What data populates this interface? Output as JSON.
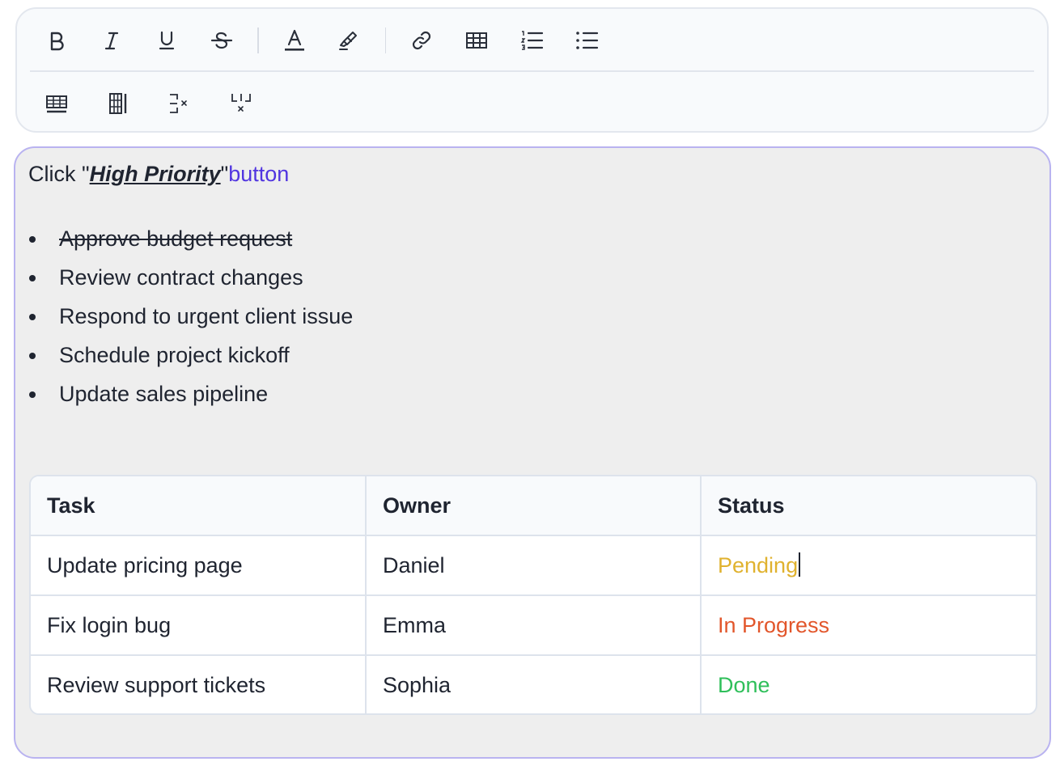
{
  "toolbar": {
    "row1": [
      {
        "name": "bold-button",
        "icon": "bold-icon"
      },
      {
        "name": "italic-button",
        "icon": "italic-icon"
      },
      {
        "name": "underline-button",
        "icon": "underline-icon"
      },
      {
        "name": "strikethrough-button",
        "icon": "strikethrough-icon"
      },
      {
        "name": "text-color-button",
        "icon": "text-color-icon"
      },
      {
        "name": "highlight-button",
        "icon": "highlighter-icon"
      },
      {
        "name": "link-button",
        "icon": "link-icon"
      },
      {
        "name": "insert-table-button",
        "icon": "table-icon"
      },
      {
        "name": "ordered-list-button",
        "icon": "ordered-list-icon"
      },
      {
        "name": "bullet-list-button",
        "icon": "bullet-list-icon"
      }
    ],
    "row2": [
      {
        "name": "add-row-button",
        "icon": "add-row-icon"
      },
      {
        "name": "add-column-button",
        "icon": "add-column-icon"
      },
      {
        "name": "delete-row-button",
        "icon": "delete-row-icon"
      },
      {
        "name": "delete-column-button",
        "icon": "delete-column-icon"
      }
    ]
  },
  "editor": {
    "line1": {
      "prefix": "Click \"",
      "emphasis": "High Priority",
      "suffix": "\"",
      "link_word": "button"
    },
    "tasks": [
      {
        "text": "Approve budget request",
        "struck": true
      },
      {
        "text": "Review contract changes",
        "struck": false
      },
      {
        "text": "Respond to urgent client issue",
        "struck": false
      },
      {
        "text": "Schedule project kickoff",
        "struck": false
      },
      {
        "text": "Update sales pipeline",
        "struck": false
      }
    ],
    "table": {
      "headers": [
        "Task",
        "Owner",
        "Status"
      ],
      "rows": [
        {
          "task": "Update pricing page",
          "owner": "Daniel",
          "status": "Pending"
        },
        {
          "task": "Fix login bug",
          "owner": "Emma",
          "status": "In Progress"
        },
        {
          "task": "Review support tickets",
          "owner": "Sophia",
          "status": "Done"
        }
      ]
    }
  },
  "colors": {
    "accent": "#5135e0",
    "editor_border": "#b9b3f0",
    "status_pending": "#e0b22f",
    "status_in_progress": "#e2562b",
    "status_done": "#2fbf5a"
  }
}
